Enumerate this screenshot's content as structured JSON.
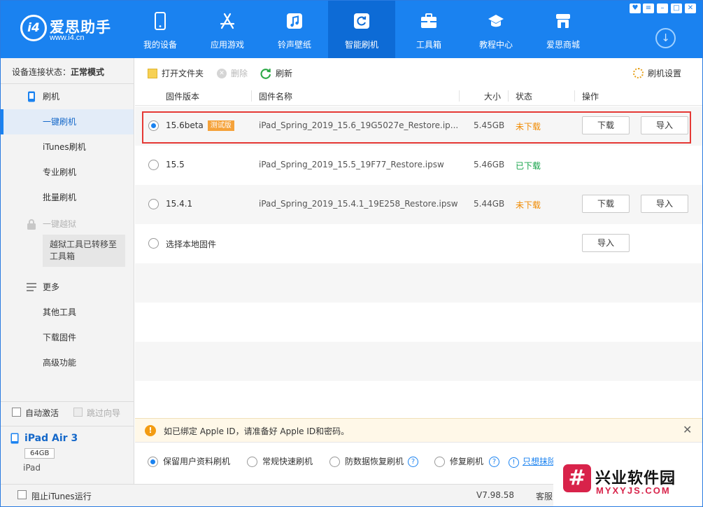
{
  "app": {
    "logo_mark": "i4",
    "name": "爱思助手",
    "url": "www.i4.cn"
  },
  "nav": [
    {
      "label": "我的设备",
      "icon": "phone-icon"
    },
    {
      "label": "应用游戏",
      "icon": "appstore-icon"
    },
    {
      "label": "铃声壁纸",
      "icon": "music-icon"
    },
    {
      "label": "智能刷机",
      "icon": "refresh-icon",
      "active": true
    },
    {
      "label": "工具箱",
      "icon": "toolbox-icon"
    },
    {
      "label": "教程中心",
      "icon": "graduation-cap-icon"
    },
    {
      "label": "爱思商城",
      "icon": "store-icon"
    }
  ],
  "sidebar": {
    "connection_label": "设备连接状态：",
    "connection_status": "正常模式",
    "flash_group": "刷机",
    "flash_items": [
      "一键刷机",
      "iTunes刷机",
      "专业刷机",
      "批量刷机"
    ],
    "jailbreak_group": "一键越狱",
    "jailbreak_tip": "越狱工具已转移至工具箱",
    "more_group": "更多",
    "more_items": [
      "其他工具",
      "下载固件",
      "高级功能"
    ],
    "auto_activate": "自动激活",
    "skip_guide": "跳过向导",
    "device_name": "iPad Air 3",
    "device_capacity": "64GB",
    "device_type": "iPad"
  },
  "toolbar": {
    "open_folder": "打开文件夹",
    "delete": "删除",
    "refresh": "刷新",
    "settings": "刷机设置"
  },
  "columns": {
    "version": "固件版本",
    "name": "固件名称",
    "size": "大小",
    "status": "状态",
    "action": "操作"
  },
  "firmware": [
    {
      "version": "15.6beta",
      "badge": "测试版",
      "name": "iPad_Spring_2019_15.6_19G5027e_Restore.ip...",
      "size": "5.45GB",
      "status": "未下载",
      "download": "下载",
      "import": "导入",
      "selected": true
    },
    {
      "version": "15.5",
      "name": "iPad_Spring_2019_15.5_19F77_Restore.ipsw",
      "size": "5.46GB",
      "status": "已下载"
    },
    {
      "version": "15.4.1",
      "name": "iPad_Spring_2019_15.4.1_19E258_Restore.ipsw",
      "size": "5.44GB",
      "status": "未下载",
      "download": "下载",
      "import": "导入"
    },
    {
      "version": "选择本地固件",
      "import": "导入"
    }
  ],
  "notice": "如已绑定 Apple ID，请准备好 Apple ID和密码。",
  "flash_options": [
    {
      "label": "保留用户资料刷机",
      "selected": true
    },
    {
      "label": "常规快速刷机"
    },
    {
      "label": "防数据恢复刷机"
    },
    {
      "label": "修复刷机"
    }
  ],
  "wipe_link": "只想抹除",
  "statusbar": {
    "block_itunes": "阻止iTunes运行",
    "version": "V7.98.58",
    "service": "客服"
  },
  "watermark": {
    "title": "兴业软件园",
    "url": "MYXYJS.COM"
  },
  "colors": {
    "brand_blue": "#1a82f0",
    "not_downloaded": "#f08a00",
    "downloaded": "#16a34a",
    "beta_badge": "#f5a23a",
    "highlight": "#e53935"
  }
}
